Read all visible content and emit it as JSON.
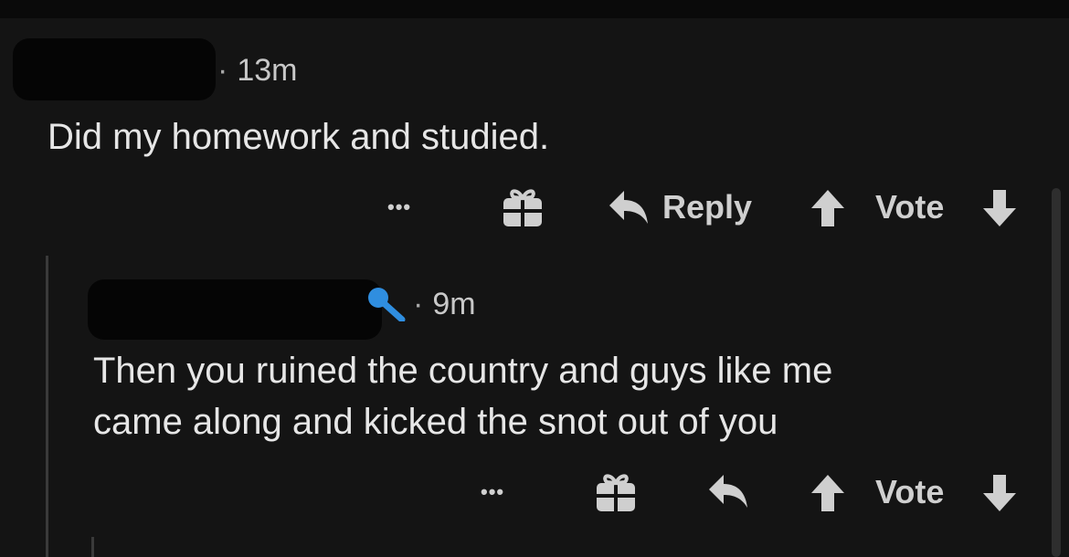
{
  "comments": [
    {
      "time": "13m",
      "separator": "·",
      "body": "Did my homework and studied.",
      "actions": {
        "more_label": "•••",
        "reply_label": "Reply",
        "vote_label": "Vote"
      }
    },
    {
      "time": "9m",
      "separator": "·",
      "body_line1": "Then you ruined the country and guys like me",
      "body_line2": "came along and kicked the snot out of you",
      "actions": {
        "more_label": "•••",
        "vote_label": "Vote"
      }
    }
  ],
  "colors": {
    "background": "#141414",
    "text": "#e6e6e6",
    "muted": "#c8c8c8",
    "badge_blue": "#2f8ee0"
  },
  "icons": [
    "more-icon",
    "gift-icon",
    "reply-arrow-icon",
    "upvote-icon",
    "downvote-icon",
    "badge-icon"
  ]
}
